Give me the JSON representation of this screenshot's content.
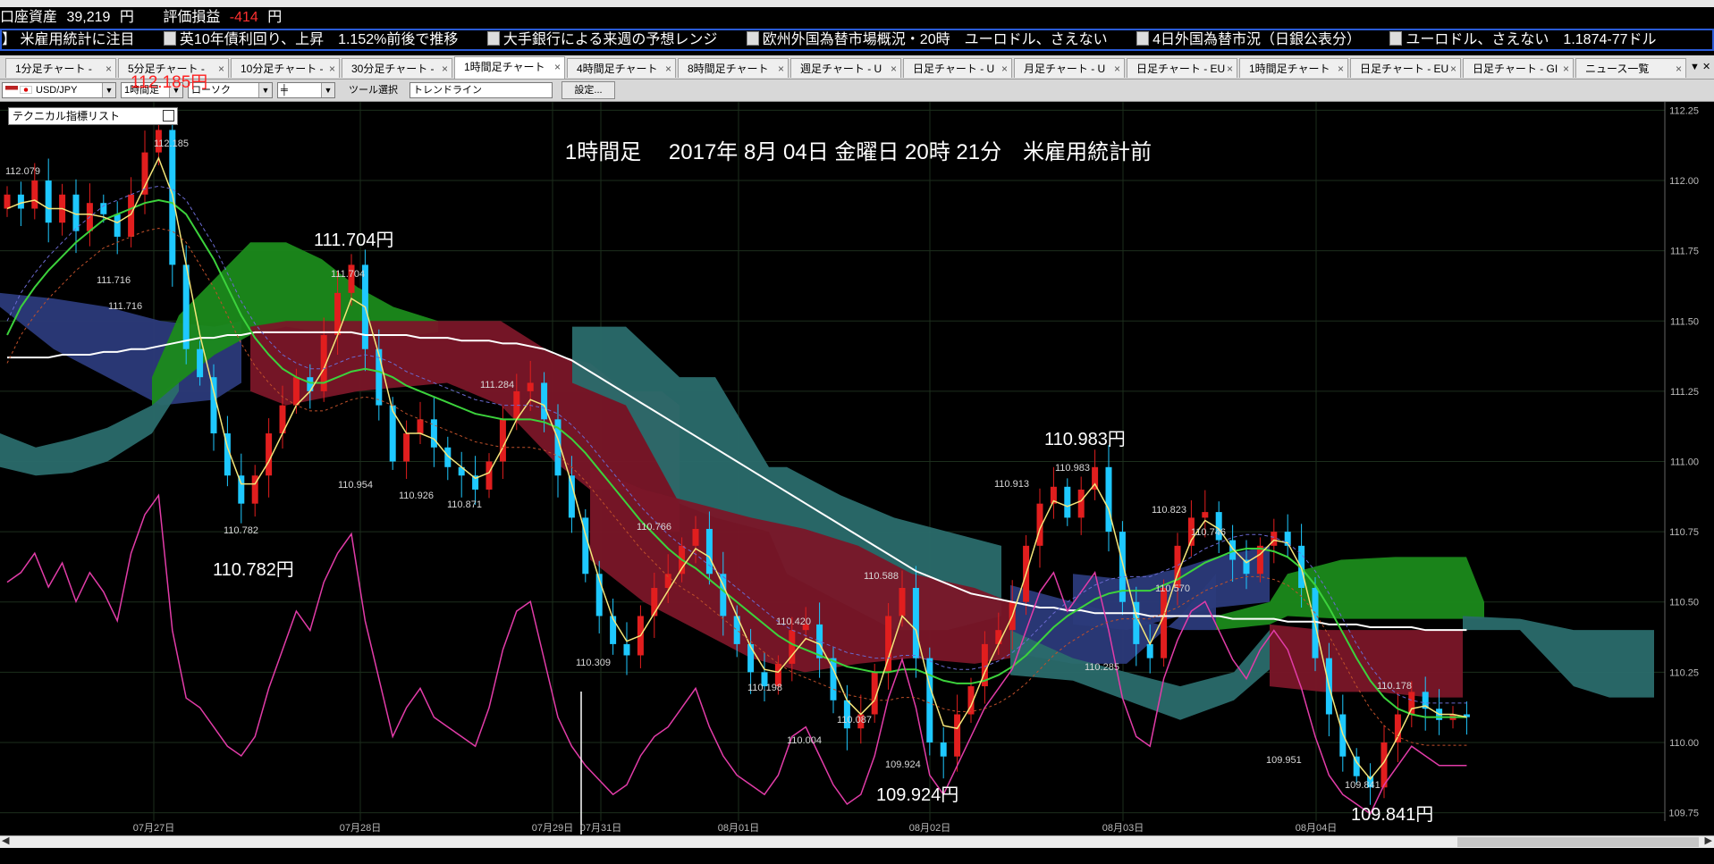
{
  "account": {
    "balance_label": "口座資産",
    "balance_value": "39,219",
    "balance_unit": "円",
    "pl_label": "評価損益",
    "pl_value": "-414",
    "pl_unit": "円"
  },
  "ticker": [
    "米雇用統計に注目",
    "英10年債利回り、上昇　1.152%前後で推移",
    "大手銀行による来週の予想レンジ",
    "欧州外国為替市場概況・20時　ユーロドル、さえない",
    "4日外国為替市況（日銀公表分）",
    "ユーロドル、さえない　1.1874-77ドル"
  ],
  "tabs": [
    {
      "label": "1分足チャート - "
    },
    {
      "label": "5分足チャート - "
    },
    {
      "label": "10分足チャート - "
    },
    {
      "label": "30分足チャート - "
    },
    {
      "label": "1時間足チャート"
    },
    {
      "label": "4時間足チャート"
    },
    {
      "label": "8時間足チャート"
    },
    {
      "label": "週足チャート - U"
    },
    {
      "label": "日足チャート - U"
    },
    {
      "label": "月足チャート - U"
    },
    {
      "label": "日足チャート - EU"
    },
    {
      "label": "1時間足チャート"
    },
    {
      "label": "日足チャート - EU"
    },
    {
      "label": "日足チャート - GI"
    },
    {
      "label": "ニュース一覧"
    }
  ],
  "controls": {
    "pair": "USD/JPY",
    "timeframe": "1時間足",
    "chart_type": "ローソク",
    "tool_label": "ツール選択",
    "tool_value": "トレンドライン",
    "settings_label": "設定...",
    "current_price": "112.185円",
    "indicator_list": "テクニカル指標リスト"
  },
  "colors": {
    "bull": "#e11e1e",
    "bear": "#1ec8ff",
    "kumo_up": "#1b8a1b",
    "kumo_down": "#7a1628",
    "kumo_teal": "#2a6b6b",
    "kumo_navy": "#2b3a7a",
    "sma_long": "#ffffff",
    "sma_mid": "#3cd23c",
    "sma_short": "#f5e67a",
    "rsi": "#e23ca8"
  },
  "chart_data": {
    "type": "candlestick",
    "title": "1時間足　 2017年 8月 04日 金曜日 20時 21分　米雇用統計前",
    "y_ticks": [
      112.25,
      112.0,
      111.75,
      111.5,
      111.25,
      111.0,
      110.75,
      110.5,
      110.25,
      110.0,
      109.75
    ],
    "y_range": [
      109.72,
      112.28
    ],
    "x_ticks": [
      "07月27日",
      "07月28日",
      "07月29日",
      "07月31日",
      "08月01日",
      "08月02日",
      "08月03日",
      "08月04日"
    ],
    "big_labels": [
      {
        "text": "111.704円",
        "price": 111.704
      },
      {
        "text": "110.782円",
        "price": 110.782
      },
      {
        "text": "110.983円",
        "price": 110.983
      },
      {
        "text": "109.924円",
        "price": 109.924
      },
      {
        "text": "109.841円",
        "price": 109.841
      }
    ],
    "price_labels": [
      {
        "text": "112.079",
        "price": 112.079
      },
      {
        "text": "112.185",
        "price": 112.185
      },
      {
        "text": "111.716",
        "price": 111.716
      },
      {
        "text": "111.716",
        "price": 111.716
      },
      {
        "text": "111.704",
        "price": 111.704
      },
      {
        "text": "111.284",
        "price": 111.284
      },
      {
        "text": "110.954",
        "price": 110.954
      },
      {
        "text": "110.926",
        "price": 110.926
      },
      {
        "text": "110.871",
        "price": 110.871
      },
      {
        "text": "110.782",
        "price": 110.782
      },
      {
        "text": "110.766",
        "price": 110.766
      },
      {
        "text": "110.309",
        "price": 110.309
      },
      {
        "text": "110.198",
        "price": 110.198
      },
      {
        "text": "110.420",
        "price": 110.42
      },
      {
        "text": "110.004",
        "price": 110.004
      },
      {
        "text": "110.087",
        "price": 110.087
      },
      {
        "text": "110.588",
        "price": 110.588
      },
      {
        "text": "109.924",
        "price": 109.924
      },
      {
        "text": "110.913",
        "price": 110.913
      },
      {
        "text": "110.983",
        "price": 110.983
      },
      {
        "text": "110.285",
        "price": 110.285
      },
      {
        "text": "110.823",
        "price": 110.823
      },
      {
        "text": "110.570",
        "price": 110.57
      },
      {
        "text": "110.746",
        "price": 110.746
      },
      {
        "text": "109.951",
        "price": 109.951
      },
      {
        "text": "110.178",
        "price": 110.178
      },
      {
        "text": "109.841",
        "price": 109.841
      }
    ],
    "close_series": [
      111.95,
      111.9,
      112.0,
      111.85,
      111.95,
      111.82,
      111.92,
      111.88,
      111.8,
      111.95,
      112.1,
      112.18,
      111.7,
      111.4,
      111.3,
      111.1,
      110.95,
      110.85,
      110.95,
      111.1,
      111.2,
      111.3,
      111.25,
      111.45,
      111.6,
      111.7,
      111.4,
      111.2,
      111.0,
      111.1,
      111.15,
      111.05,
      110.98,
      110.95,
      110.9,
      111.0,
      111.15,
      111.25,
      111.28,
      111.15,
      110.95,
      110.8,
      110.6,
      110.45,
      110.35,
      110.31,
      110.45,
      110.55,
      110.6,
      110.7,
      110.76,
      110.6,
      110.45,
      110.35,
      110.25,
      110.2,
      110.28,
      110.4,
      110.42,
      110.3,
      110.15,
      110.05,
      110.1,
      110.25,
      110.45,
      110.55,
      110.3,
      110.0,
      109.95,
      110.1,
      110.2,
      110.35,
      110.4,
      110.5,
      110.7,
      110.85,
      110.91,
      110.8,
      110.9,
      110.98,
      110.75,
      110.5,
      110.35,
      110.3,
      110.55,
      110.7,
      110.8,
      110.82,
      110.72,
      110.65,
      110.6,
      110.7,
      110.75,
      110.7,
      110.55,
      110.3,
      110.1,
      109.95,
      109.88,
      109.84,
      110.0,
      110.1,
      110.18,
      110.12,
      110.08,
      110.1,
      110.09
    ],
    "series": [
      {
        "name": "",
        "kind": "sma_long",
        "values": [
          111.37,
          111.37,
          111.37,
          111.37,
          111.38,
          111.38,
          111.38,
          111.39,
          111.39,
          111.4,
          111.4,
          111.41,
          111.42,
          111.43,
          111.44,
          111.44,
          111.45,
          111.45,
          111.46,
          111.46,
          111.46,
          111.46,
          111.46,
          111.46,
          111.46,
          111.46,
          111.45,
          111.45,
          111.45,
          111.45,
          111.44,
          111.44,
          111.44,
          111.43,
          111.43,
          111.43,
          111.42,
          111.42,
          111.41,
          111.4,
          111.38,
          111.36,
          111.33,
          111.3,
          111.27,
          111.24,
          111.21,
          111.18,
          111.15,
          111.12,
          111.09,
          111.06,
          111.03,
          111.0,
          110.97,
          110.94,
          110.91,
          110.88,
          110.85,
          110.82,
          110.79,
          110.76,
          110.73,
          110.7,
          110.67,
          110.64,
          110.61,
          110.59,
          110.57,
          110.55,
          110.53,
          110.52,
          110.51,
          110.5,
          110.49,
          110.48,
          110.48,
          110.47,
          110.47,
          110.46,
          110.46,
          110.46,
          110.46,
          110.45,
          110.45,
          110.45,
          110.45,
          110.45,
          110.45,
          110.44,
          110.44,
          110.44,
          110.44,
          110.43,
          110.43,
          110.43,
          110.42,
          110.42,
          110.42,
          110.41,
          110.41,
          110.41,
          110.41,
          110.4,
          110.4,
          110.4,
          110.4
        ]
      },
      {
        "name": "",
        "kind": "sma_mid",
        "values": [
          111.45,
          111.55,
          111.62,
          111.68,
          111.73,
          111.78,
          111.82,
          111.86,
          111.88,
          111.9,
          111.92,
          111.93,
          111.92,
          111.88,
          111.8,
          111.72,
          111.62,
          111.52,
          111.44,
          111.38,
          111.33,
          111.3,
          111.28,
          111.28,
          111.3,
          111.32,
          111.33,
          111.32,
          111.3,
          111.27,
          111.25,
          111.23,
          111.21,
          111.19,
          111.17,
          111.16,
          111.15,
          111.15,
          111.15,
          111.14,
          111.12,
          111.08,
          111.03,
          110.97,
          110.91,
          110.85,
          110.79,
          110.74,
          110.69,
          110.65,
          110.62,
          110.58,
          110.54,
          110.5,
          110.46,
          110.42,
          110.38,
          110.35,
          110.33,
          110.31,
          110.29,
          110.27,
          110.26,
          110.25,
          110.25,
          110.26,
          110.26,
          110.24,
          110.22,
          110.21,
          110.21,
          110.22,
          110.24,
          110.27,
          110.31,
          110.36,
          110.41,
          110.45,
          110.48,
          110.51,
          110.53,
          110.54,
          110.54,
          110.54,
          110.56,
          110.58,
          110.61,
          110.64,
          110.66,
          110.68,
          110.69,
          110.69,
          110.68,
          110.66,
          110.62,
          110.56,
          110.48,
          110.39,
          110.3,
          110.22,
          110.16,
          110.12,
          110.1,
          110.09,
          110.09,
          110.09,
          110.09
        ]
      },
      {
        "name": "",
        "kind": "sma_short",
        "values": [
          111.9,
          111.92,
          111.93,
          111.9,
          111.9,
          111.88,
          111.88,
          111.87,
          111.85,
          111.88,
          111.98,
          112.08,
          111.95,
          111.7,
          111.45,
          111.25,
          111.05,
          110.92,
          110.92,
          111.0,
          111.1,
          111.2,
          111.25,
          111.33,
          111.45,
          111.58,
          111.55,
          111.38,
          111.18,
          111.1,
          111.1,
          111.08,
          111.02,
          110.98,
          110.94,
          110.96,
          111.05,
          111.15,
          111.22,
          111.2,
          111.08,
          110.92,
          110.74,
          110.58,
          110.44,
          110.36,
          110.38,
          110.46,
          110.54,
          110.62,
          110.69,
          110.66,
          110.56,
          110.45,
          110.34,
          110.26,
          110.25,
          110.31,
          110.37,
          110.35,
          110.26,
          110.15,
          110.1,
          110.15,
          110.3,
          110.45,
          110.4,
          110.2,
          110.06,
          110.05,
          110.13,
          110.25,
          110.35,
          110.45,
          110.6,
          110.76,
          110.86,
          110.84,
          110.86,
          110.92,
          110.83,
          110.64,
          110.45,
          110.35,
          110.45,
          110.6,
          110.72,
          110.79,
          110.76,
          110.69,
          110.64,
          110.67,
          110.72,
          110.71,
          110.62,
          110.42,
          110.2,
          110.03,
          109.93,
          109.87,
          109.93,
          110.02,
          110.12,
          110.13,
          110.1,
          110.1,
          110.09
        ]
      },
      {
        "name": "",
        "kind": "rsi",
        "values": [
          56,
          58,
          62,
          55,
          60,
          52,
          58,
          54,
          48,
          62,
          70,
          74,
          46,
          32,
          30,
          26,
          22,
          20,
          24,
          34,
          42,
          50,
          46,
          56,
          62,
          66,
          48,
          36,
          24,
          30,
          34,
          28,
          26,
          24,
          22,
          30,
          42,
          50,
          52,
          40,
          28,
          22,
          18,
          15,
          12,
          14,
          20,
          24,
          26,
          30,
          34,
          26,
          20,
          16,
          14,
          12,
          16,
          24,
          26,
          20,
          14,
          10,
          12,
          20,
          32,
          40,
          30,
          16,
          12,
          18,
          24,
          30,
          34,
          38,
          46,
          54,
          58,
          50,
          54,
          58,
          46,
          32,
          24,
          22,
          36,
          44,
          50,
          52,
          46,
          40,
          36,
          42,
          46,
          42,
          34,
          24,
          16,
          12,
          10,
          8,
          14,
          18,
          22,
          20,
          18,
          18,
          18
        ]
      }
    ]
  }
}
